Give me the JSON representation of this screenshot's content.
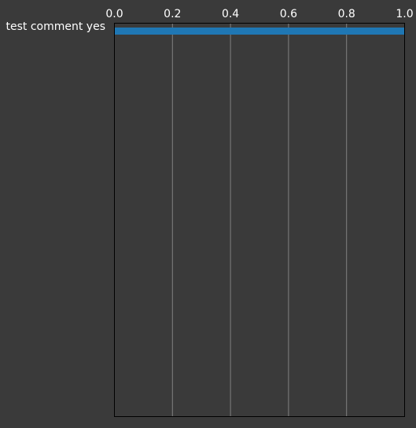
{
  "chart_data": {
    "type": "bar",
    "orientation": "horizontal",
    "categories": [
      "test comment yes"
    ],
    "values": [
      1.0
    ],
    "xlim": [
      0.0,
      1.0
    ],
    "xticks": [
      "0.0",
      "0.2",
      "0.4",
      "0.6",
      "0.8",
      "1.0"
    ],
    "xaxis_position": "top",
    "grid": true,
    "title": "",
    "xlabel": "",
    "ylabel": "",
    "colors": {
      "background": "#3a3a3a",
      "bar": "#1f77b4",
      "grid": "#808080",
      "text": "#ffffff",
      "frame": "#000000"
    }
  }
}
